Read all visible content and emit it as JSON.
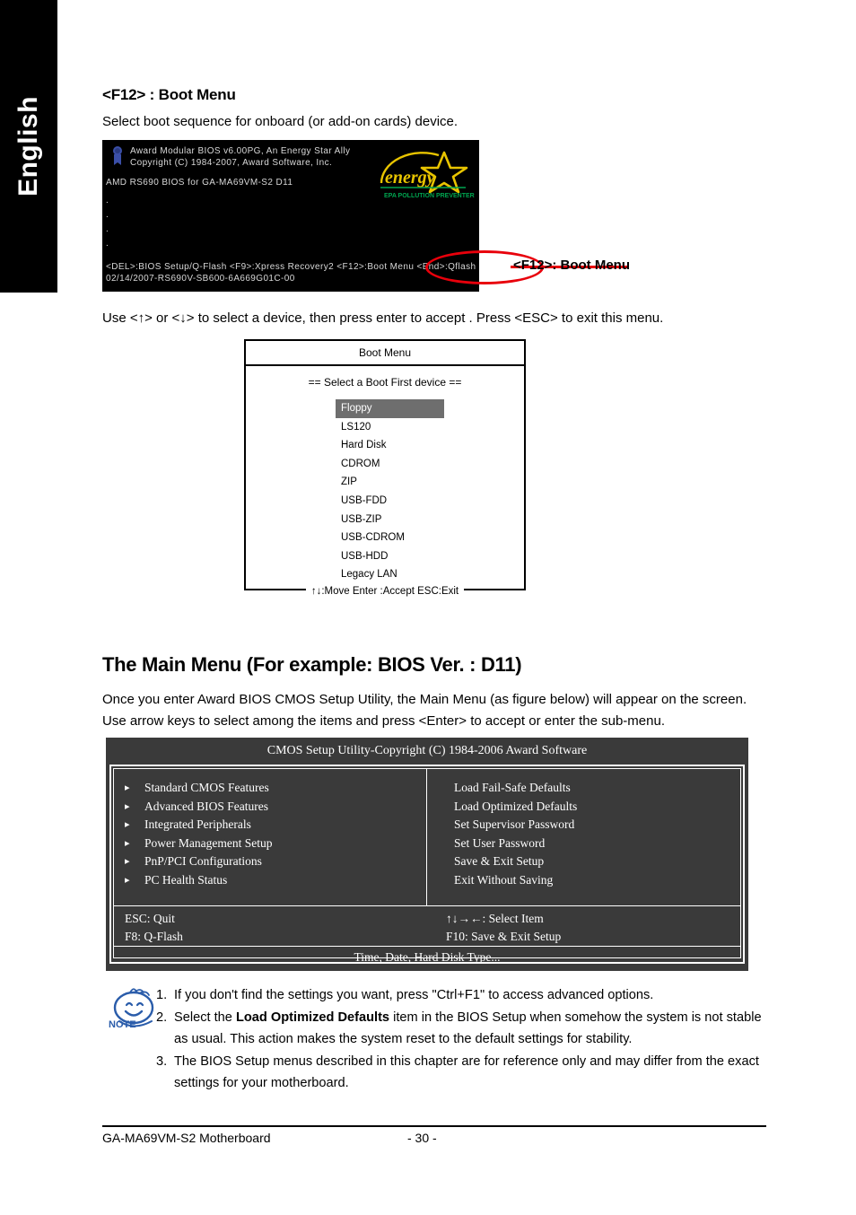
{
  "sidebar": {
    "language_tab": "English"
  },
  "f12_section": {
    "heading": "<F12> : Boot Menu",
    "subtitle": "Select boot sequence for onboard (or add-on cards) device.",
    "callout_label": "<F12>: Boot Menu",
    "instruction": "Use <↑> or <↓> to select a device, then press enter to accept . Press <ESC> to exit this menu."
  },
  "bios_splash": {
    "line1": "Award Modular BIOS v6.00PG, An Energy Star Ally",
    "line2": "Copyright  (C) 1984-2007, Award Software,  Inc.",
    "line3": "AMD RS690 BIOS for GA-MA69VM-S2 D11",
    "dot": ".",
    "line4": "<DEL>:BIOS Setup/Q-Flash <F9>:Xpress Recovery2 <F12>:Boot Menu <End>:Qflash",
    "line5": "02/14/2007-RS690V-SB600-6A669G01C-00",
    "energy_logo_word": "energy",
    "energy_logo_sub": "EPA  POLLUTION PREVENTER",
    "colors": {
      "background": "#000000",
      "text": "#d8d8d8",
      "energy_yellow": "#e8c400",
      "energy_green": "#00a550",
      "annotation_red": "#e8000b"
    }
  },
  "boot_menu": {
    "title": "Boot Menu",
    "subtitle": "==  Select a Boot First device  ==",
    "items": [
      "Floppy",
      "LS120",
      "Hard Disk",
      "CDROM",
      "ZIP",
      "USB-FDD",
      "USB-ZIP",
      "USB-CDROM",
      "USB-HDD",
      "Legacy LAN"
    ],
    "selected_index": 0,
    "footer": "↑↓:Move   Enter :Accept   ESC:Exit",
    "highlight_color": "#6e6e6e"
  },
  "main_menu_section": {
    "heading": "The Main Menu (For example: BIOS Ver. : D11)",
    "paragraph1": "Once you enter Award BIOS CMOS Setup Utility, the Main Menu (as figure below) will appear on the screen.",
    "paragraph2": "Use arrow keys to select among the items and press <Enter> to accept or enter the sub-menu."
  },
  "cmos_setup": {
    "title": "CMOS Setup Utility-Copyright (C) 1984-2006 Award Software",
    "bullet_glyph": "▸",
    "left_items": [
      "Standard CMOS Features",
      "Advanced BIOS Features",
      "Integrated Peripherals",
      "Power Management Setup",
      "PnP/PCI Configurations",
      "PC Health Status"
    ],
    "right_items": [
      "Load Fail-Safe Defaults",
      "Load Optimized Defaults",
      "Set Supervisor Password",
      "Set User Password",
      "Save & Exit Setup",
      "Exit Without Saving"
    ],
    "keys_left": [
      "ESC: Quit",
      "F8:  Q-Flash"
    ],
    "keys_right": [
      "↑↓→←: Select Item",
      "F10: Save & Exit Setup"
    ],
    "status_bar": "Time, Date, Hard Disk Type...",
    "background": "#3a3a3a"
  },
  "note": {
    "icon_label": "NOTE",
    "items": [
      {
        "num": "1.",
        "pre": "If you don't find the settings you want, press \"Ctrl+F1\" to access advanced options.",
        "bold": "",
        "post": ""
      },
      {
        "num": "2.",
        "pre": "Select the ",
        "bold": "Load Optimized Defaults",
        "post": " item in the BIOS Setup when somehow the system is not stable as usual. This action makes the system reset to the default settings for stability."
      },
      {
        "num": "3.",
        "pre": "The BIOS Setup menus described in this chapter are for reference only and may differ from the exact settings for your motherboard.",
        "bold": "",
        "post": ""
      }
    ]
  },
  "footer": {
    "product": "GA-MA69VM-S2 Motherboard",
    "page_number": "- 30 -"
  }
}
